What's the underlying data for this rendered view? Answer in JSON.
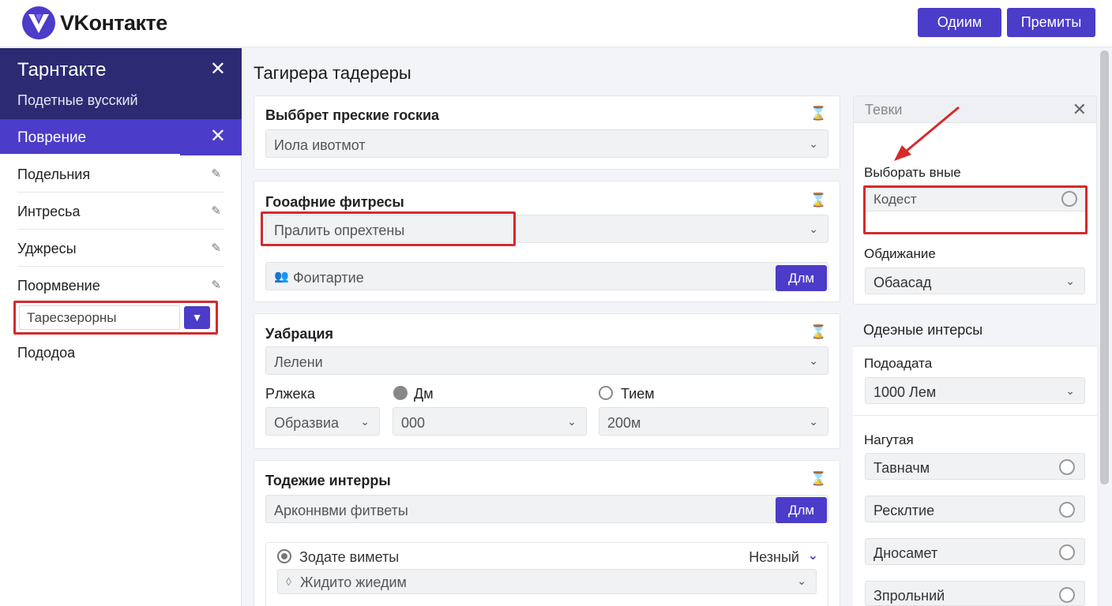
{
  "header": {
    "brand": "VKонтакте",
    "btn_primary": "Одиим",
    "btn_secondary": "Премиты",
    "logo_icon": "vk-logo-icon",
    "accent": "#4b3cc9"
  },
  "sidebar": {
    "title": "Тарнтакте",
    "subtitle": "Подетные вусский",
    "active_item": "Поврение",
    "items": [
      {
        "label": "Подельния"
      },
      {
        "label": "Интресьа"
      },
      {
        "label": "Уджресы"
      },
      {
        "label": "Поормвение"
      }
    ],
    "input_value": "Таресзерорны",
    "last_item": "Пододоа",
    "highlight_color": "#d6292c"
  },
  "main": {
    "title": "Тагирера тадереры",
    "card1": {
      "title": "Выббрет преские госкиа",
      "select": "Иола ивотмот"
    },
    "card2": {
      "title": "Гооафние фитресы",
      "select": "Прaлить опрехтены",
      "input_placeholder": "Фоитартие",
      "button": "Длм"
    },
    "card3": {
      "title": "Уабрация",
      "select": "Лелени",
      "label_a": "Рлжека",
      "radio_b": "Дм",
      "radio_c": "Тием",
      "select_a": "Образвиа",
      "select_b": "000",
      "select_c": "200м"
    },
    "card4": {
      "title": "Тодежие интерры",
      "input_value": "Арконнвми фитветы",
      "button": "Длм",
      "sub_label": "Зодате виметы",
      "sub_right": "Незный",
      "sub_select": "Жидито жиедим"
    }
  },
  "right": {
    "header": "Тевки",
    "label1": "Выборать вные",
    "input_value": "Кодест",
    "label2": "Обдижание",
    "select2": "Обаасад",
    "section": "Одеэные интерсы",
    "label3": "Подоадата",
    "select3": "1000 Лем",
    "label4": "Нагутая",
    "options": [
      "Тавначм",
      "Ресклтие",
      "Дносамет",
      "Зпрольний"
    ]
  }
}
